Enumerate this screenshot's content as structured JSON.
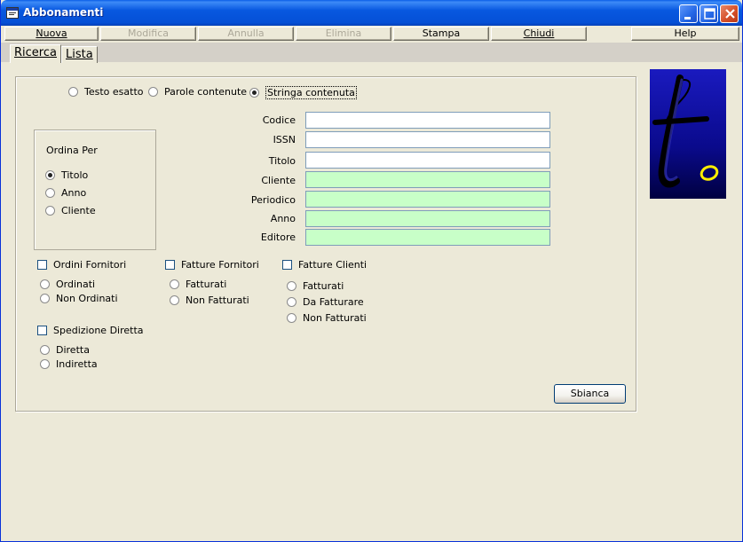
{
  "window": {
    "title": "Abbonamenti"
  },
  "toolbar": {
    "nuova": "Nuova",
    "modifica": "Modifica",
    "annulla": "Annulla",
    "elimina": "Elimina",
    "stampa": "Stampa",
    "chiudi": "Chiudi",
    "help": "Help"
  },
  "tabs": {
    "ricerca": "Ricerca",
    "lista": "Lista"
  },
  "search_mode": {
    "options": [
      "Testo esatto",
      "Parole contenute",
      "Stringa contenuta"
    ],
    "selected": "Stringa contenuta"
  },
  "sort": {
    "title": "Ordina Per",
    "options": [
      "Titolo",
      "Anno",
      "Cliente"
    ],
    "selected": "Titolo"
  },
  "fields": {
    "codice": {
      "label": "Codice",
      "value": ""
    },
    "issn": {
      "label": "ISSN",
      "value": ""
    },
    "titolo": {
      "label": "Titolo",
      "value": ""
    },
    "cliente": {
      "label": "Cliente",
      "value": ""
    },
    "periodico": {
      "label": "Periodico",
      "value": ""
    },
    "anno": {
      "label": "Anno",
      "value": ""
    },
    "editore": {
      "label": "Editore",
      "value": ""
    }
  },
  "filters": {
    "ordini_fornitori": {
      "label": "Ordini Fornitori",
      "options": [
        "Ordinati",
        "Non Ordinati"
      ]
    },
    "fatture_fornitori": {
      "label": "Fatture Fornitori",
      "options": [
        "Fatturati",
        "Non Fatturati"
      ]
    },
    "fatture_clienti": {
      "label": "Fatture Clienti",
      "options": [
        "Fatturati",
        "Da Fatturare",
        "Non Fatturati"
      ]
    },
    "spedizione_diretta": {
      "label": "Spedizione Diretta",
      "options": [
        "Diretta",
        "Indiretta"
      ]
    }
  },
  "buttons": {
    "sbianca": "Sbianca"
  },
  "colors": {
    "titlebar": "#0550D6",
    "required_field": "#C8FFC8",
    "window_bg": "#ECE9D8",
    "logo_bg": "#0A0A8C",
    "logo_accent": "#FFEE00"
  },
  "icons": {
    "app": "app-window-icon",
    "minimize": "minimize-icon",
    "maximize": "maximize-icon",
    "close": "close-icon",
    "logo": "to-logo"
  }
}
